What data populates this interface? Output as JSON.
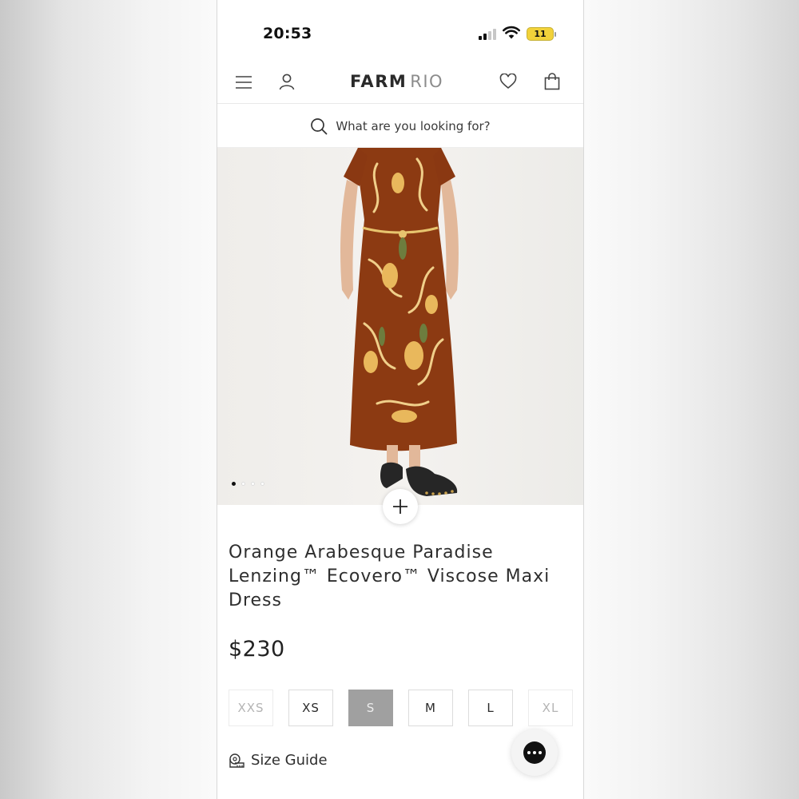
{
  "status_bar": {
    "time": "20:53",
    "battery": "11"
  },
  "header": {
    "brand_primary": "FARM",
    "brand_secondary": "RIO",
    "menu_icon": "hamburger-icon",
    "account_icon": "user-icon",
    "wishlist_icon": "heart-icon",
    "bag_icon": "shopping-bag-icon"
  },
  "search": {
    "placeholder": "What are you looking for?",
    "icon": "search-icon"
  },
  "gallery": {
    "image_count": 4,
    "active_index": 0
  },
  "product": {
    "title": "Orange Arabesque Paradise Lenzing™ Ecovero™ Viscose Maxi Dress",
    "price": "$230",
    "dress_color": "#8c3a12"
  },
  "sizes": [
    {
      "label": "XXS",
      "state": "disabled"
    },
    {
      "label": "XS",
      "state": "available"
    },
    {
      "label": "S",
      "state": "selected"
    },
    {
      "label": "M",
      "state": "available"
    },
    {
      "label": "L",
      "state": "available"
    },
    {
      "label": "XL",
      "state": "disabled"
    }
  ],
  "size_guide": {
    "label": "Size Guide",
    "icon": "measuring-tape-icon"
  },
  "chat": {
    "icon": "chat-icon"
  }
}
